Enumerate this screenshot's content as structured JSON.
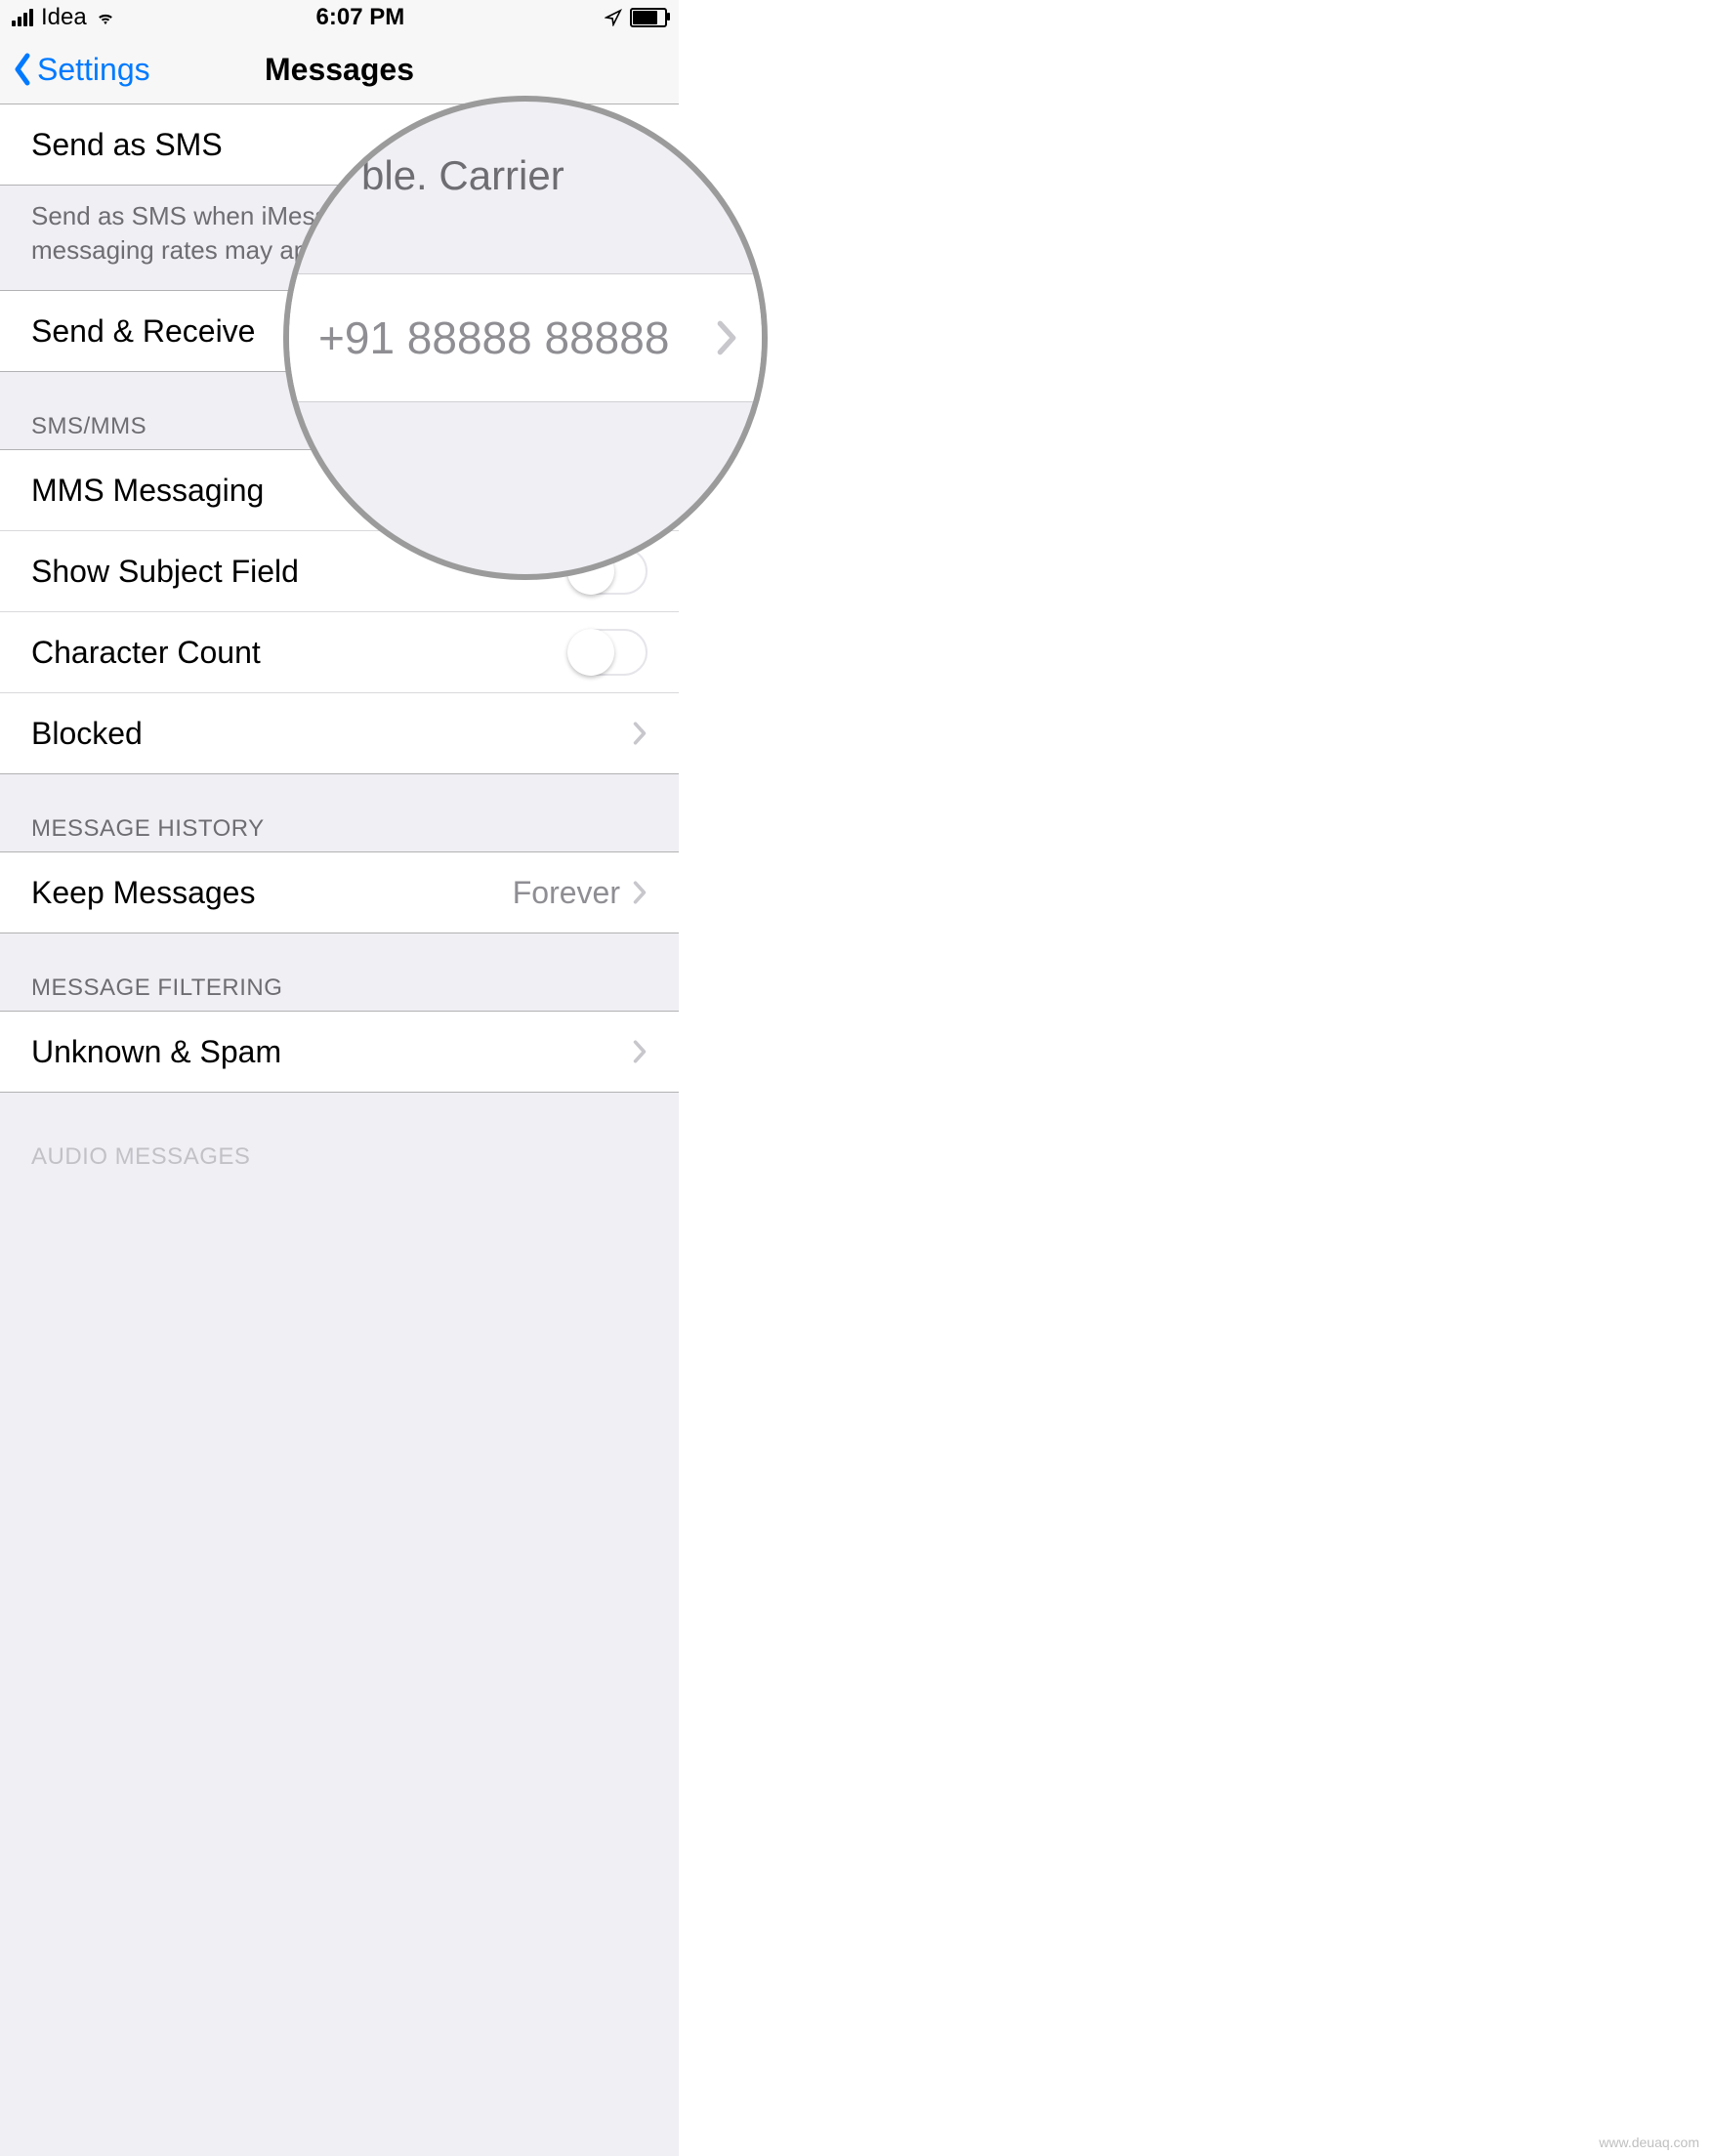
{
  "statusbar": {
    "carrier": "Idea",
    "time": "6:07 PM"
  },
  "nav": {
    "back": "Settings",
    "title": "Messages"
  },
  "rows": {
    "send_as_sms": "Send as SMS",
    "send_as_sms_footer": "Send as SMS when iMessage is unavailable. Carrier messaging rates may apply.",
    "send_receive": "Send & Receive",
    "mms": "MMS Messaging",
    "subject": "Show Subject Field",
    "charcount": "Character Count",
    "blocked": "Blocked",
    "keep_messages": "Keep Messages",
    "keep_messages_value": "Forever",
    "unknown_spam": "Unknown & Spam"
  },
  "sections": {
    "smsmms": "SMS/MMS",
    "history": "MESSAGE HISTORY",
    "filtering": "MESSAGE FILTERING",
    "audio": "AUDIO MESSAGES"
  },
  "magnifier": {
    "top_fragment": "ble. Carrier",
    "phone_number": "+91 88888 88888"
  },
  "watermark": "www.deuaq.com"
}
